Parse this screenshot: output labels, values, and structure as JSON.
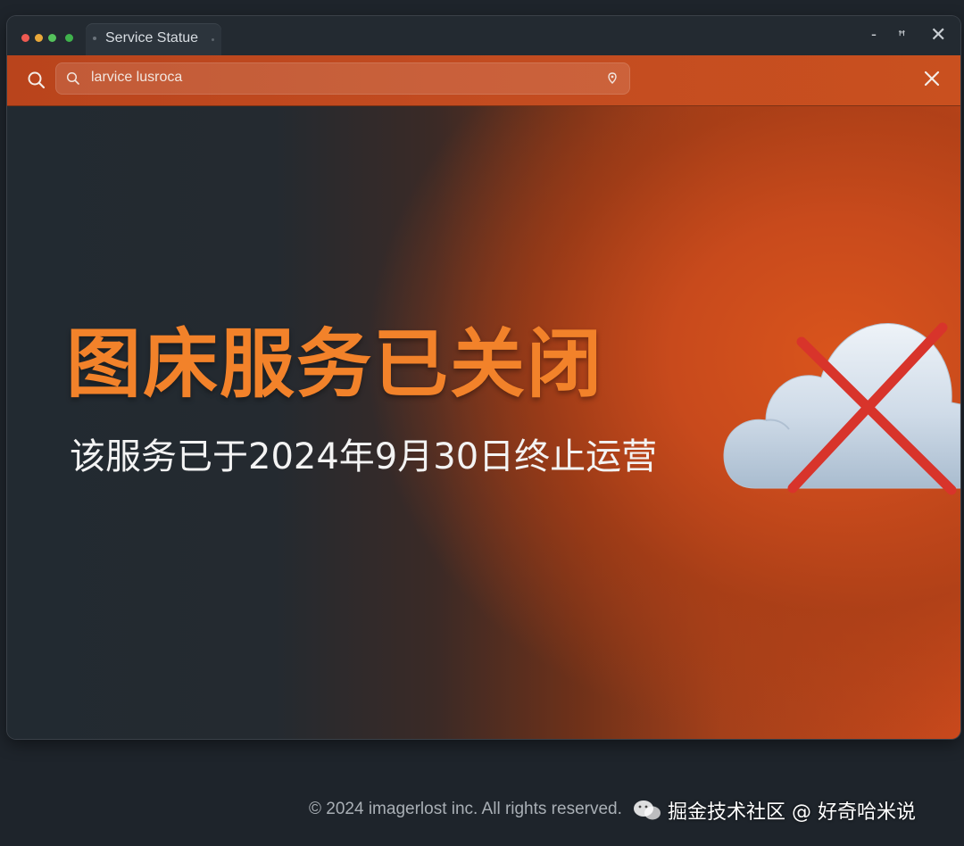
{
  "window": {
    "tab_title": "Service Statue"
  },
  "window_controls": {
    "minimize": "-",
    "maximize": "ꟸ",
    "close": "✕"
  },
  "search": {
    "value": "larvice lusroca",
    "icons": [
      "search-icon",
      "pin-icon",
      "close-icon"
    ]
  },
  "main": {
    "headline": "图床服务已关闭",
    "subline": "该服务已于2024年9月30日终止运营",
    "graphic": "cloud-with-red-x"
  },
  "footer": {
    "copyright": "© 2024 imagerlost inc. All rights reserved."
  },
  "watermark": {
    "text": "掘金技术社区 @ 好奇哈米说"
  },
  "colors": {
    "accent_orange": "#f2822a",
    "band_orange": "#c24b20",
    "background_dark": "#1e242b",
    "cross_red": "#d8342b"
  }
}
